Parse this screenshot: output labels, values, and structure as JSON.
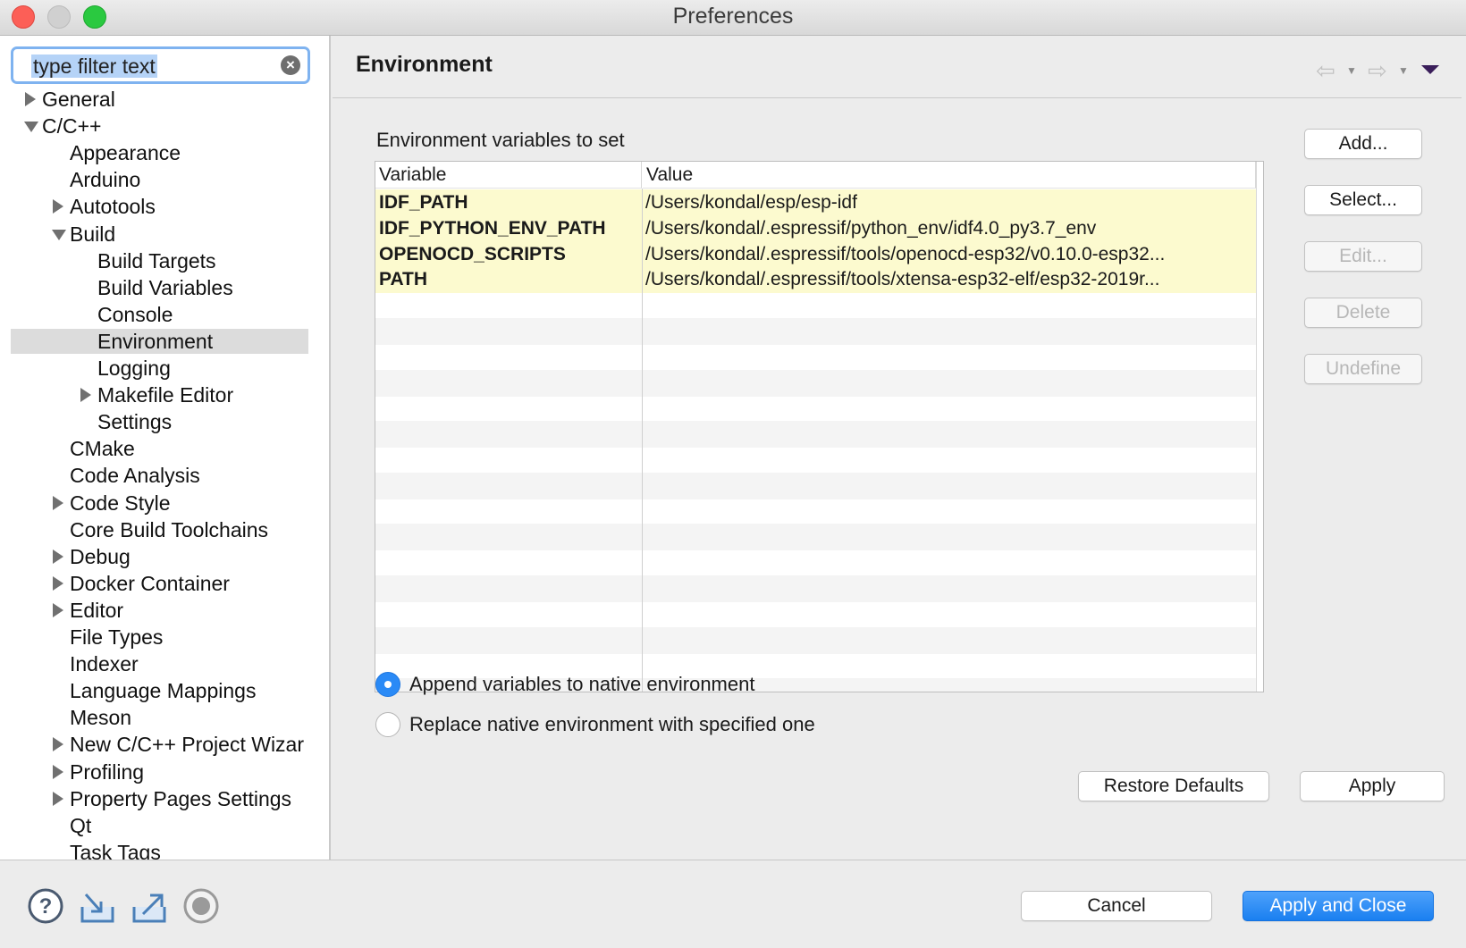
{
  "window": {
    "title": "Preferences"
  },
  "filter": {
    "placeholder": "type filter text"
  },
  "tree": [
    {
      "label": "General",
      "level": 0,
      "arrow": "right"
    },
    {
      "label": "C/C++",
      "level": 0,
      "arrow": "down"
    },
    {
      "label": "Appearance",
      "level": 1,
      "arrow": "none"
    },
    {
      "label": "Arduino",
      "level": 1,
      "arrow": "none"
    },
    {
      "label": "Autotools",
      "level": 1,
      "arrow": "right"
    },
    {
      "label": "Build",
      "level": 1,
      "arrow": "down"
    },
    {
      "label": "Build Targets",
      "level": 2,
      "arrow": "none"
    },
    {
      "label": "Build Variables",
      "level": 2,
      "arrow": "none"
    },
    {
      "label": "Console",
      "level": 2,
      "arrow": "none"
    },
    {
      "label": "Environment",
      "level": 2,
      "arrow": "none",
      "selected": true
    },
    {
      "label": "Logging",
      "level": 2,
      "arrow": "none"
    },
    {
      "label": "Makefile Editor",
      "level": 2,
      "arrow": "right"
    },
    {
      "label": "Settings",
      "level": 2,
      "arrow": "none"
    },
    {
      "label": "CMake",
      "level": 1,
      "arrow": "none"
    },
    {
      "label": "Code Analysis",
      "level": 1,
      "arrow": "none"
    },
    {
      "label": "Code Style",
      "level": 1,
      "arrow": "right"
    },
    {
      "label": "Core Build Toolchains",
      "level": 1,
      "arrow": "none"
    },
    {
      "label": "Debug",
      "level": 1,
      "arrow": "right"
    },
    {
      "label": "Docker Container",
      "level": 1,
      "arrow": "right"
    },
    {
      "label": "Editor",
      "level": 1,
      "arrow": "right"
    },
    {
      "label": "File Types",
      "level": 1,
      "arrow": "none"
    },
    {
      "label": "Indexer",
      "level": 1,
      "arrow": "none"
    },
    {
      "label": "Language Mappings",
      "level": 1,
      "arrow": "none"
    },
    {
      "label": "Meson",
      "level": 1,
      "arrow": "none"
    },
    {
      "label": "New C/C++ Project Wizar",
      "level": 1,
      "arrow": "right"
    },
    {
      "label": "Profiling",
      "level": 1,
      "arrow": "right"
    },
    {
      "label": "Property Pages Settings",
      "level": 1,
      "arrow": "right"
    },
    {
      "label": "Qt",
      "level": 1,
      "arrow": "none"
    },
    {
      "label": "Task Tags",
      "level": 1,
      "arrow": "none"
    }
  ],
  "page": {
    "title": "Environment",
    "section_label": "Environment variables to set",
    "nav_back_icon": "back-arrow-icon",
    "nav_forward_icon": "forward-arrow-icon"
  },
  "table": {
    "headers": [
      "Variable",
      "Value"
    ],
    "rows": [
      {
        "variable": "IDF_PATH",
        "value": "/Users/kondal/esp/esp-idf"
      },
      {
        "variable": "IDF_PYTHON_ENV_PATH",
        "value": "/Users/kondal/.espressif/python_env/idf4.0_py3.7_env"
      },
      {
        "variable": "OPENOCD_SCRIPTS",
        "value": "/Users/kondal/.espressif/tools/openocd-esp32/v0.10.0-esp32..."
      },
      {
        "variable": "PATH",
        "value": "/Users/kondal/.espressif/tools/xtensa-esp32-elf/esp32-2019r..."
      }
    ],
    "highlight_color": "#fcfacf"
  },
  "side_buttons": [
    {
      "label": "Add...",
      "enabled": true
    },
    {
      "label": "Select...",
      "enabled": true
    },
    {
      "label": "Edit...",
      "enabled": false
    },
    {
      "label": "Delete",
      "enabled": false
    },
    {
      "label": "Undefine",
      "enabled": false
    }
  ],
  "radios": [
    {
      "label": "Append variables to native environment",
      "checked": true
    },
    {
      "label": "Replace native environment with specified one",
      "checked": false
    }
  ],
  "buttons": {
    "restore_defaults": "Restore Defaults",
    "apply": "Apply",
    "cancel": "Cancel",
    "apply_and_close": "Apply and Close"
  },
  "bottom_icons": [
    "help-icon",
    "import-icon",
    "export-icon",
    "record-icon"
  ],
  "colors": {
    "accent": "#1a7ff0",
    "selection": "#dcdcdc"
  }
}
